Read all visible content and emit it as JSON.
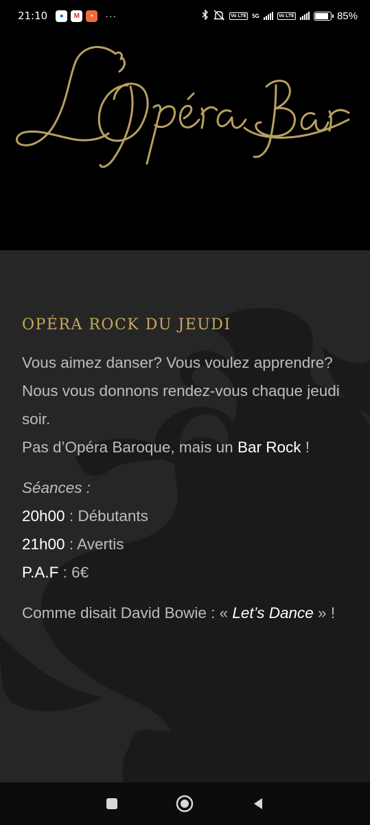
{
  "status_bar": {
    "time": "21:10",
    "apps": [
      {
        "icon": "messenger-icon",
        "glyph": "●"
      },
      {
        "icon": "gmail-icon",
        "glyph": "M"
      },
      {
        "icon": "shopping-icon",
        "glyph": "▪"
      }
    ],
    "more": "···",
    "network_5g": "5G",
    "volte": "Vo LTE",
    "battery_level": 0.85,
    "battery_pct": "85%"
  },
  "header": {
    "logo_text": "L'Opéra Bar",
    "logo_color": "#b8a060"
  },
  "section": {
    "title": "OPÉRA ROCK DU JEUDI",
    "title_color": "#c8a85c",
    "intro_1": "Vous aimez danser? Vous voulez apprendre?",
    "intro_2": "Nous vous donnons rendez-vous chaque jeudi soir.",
    "intro_3_prefix": "Pas d’Opéra Baroque, mais un ",
    "intro_3_highlight": "Bar Rock",
    "intro_3_suffix": " !",
    "sessions_label": "Séances :",
    "sessions": [
      {
        "time": "20h00",
        "desc": " : Débutants"
      },
      {
        "time": "21h00",
        "desc": " : Avertis"
      },
      {
        "time": "P.A.F",
        "desc": " : 6€"
      }
    ],
    "quote_prefix": "Comme disait David Bowie : « ",
    "quote_title": "Let’s Dance",
    "quote_suffix": " » !"
  },
  "nav_bar": {
    "recents": "recents-icon",
    "home": "home-icon",
    "back": "back-icon"
  }
}
